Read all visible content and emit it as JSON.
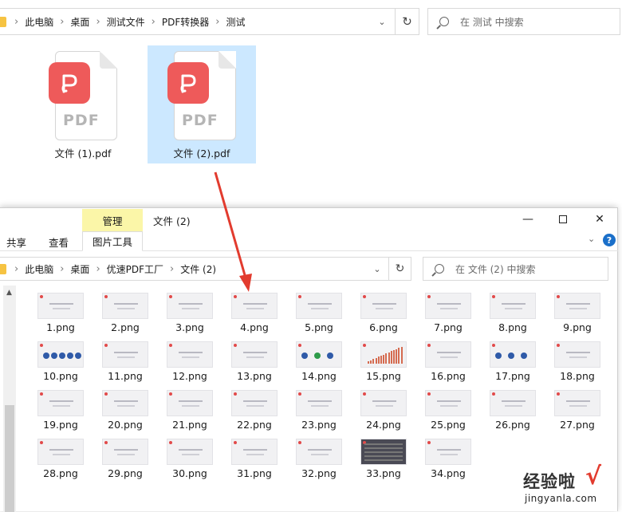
{
  "back_window": {
    "breadcrumb": [
      "此电脑",
      "桌面",
      "测试文件",
      "PDF转换器",
      "测试"
    ],
    "search_placeholder": "在 测试 中搜索",
    "files": [
      {
        "name": "文件 (1).pdf",
        "selected": false
      },
      {
        "name": "文件 (2).pdf",
        "selected": true
      }
    ],
    "pdf_badge_label": "PDF"
  },
  "front_window": {
    "title": "文件 (2)",
    "context_tab": "管理",
    "ribbon_tabs": [
      "共享",
      "查看",
      "图片工具"
    ],
    "help": "?",
    "breadcrumb": [
      "此电脑",
      "桌面",
      "优速PDF工厂",
      "文件 (2)"
    ],
    "search_placeholder": "在 文件 (2) 中搜索",
    "images": [
      "1.png",
      "2.png",
      "3.png",
      "4.png",
      "5.png",
      "6.png",
      "7.png",
      "8.png",
      "9.png",
      "10.png",
      "11.png",
      "12.png",
      "13.png",
      "14.png",
      "15.png",
      "16.png",
      "17.png",
      "18.png",
      "19.png",
      "20.png",
      "21.png",
      "22.png",
      "23.png",
      "24.png",
      "25.png",
      "26.png",
      "27.png",
      "28.png",
      "29.png",
      "30.png",
      "31.png",
      "32.png",
      "33.png",
      "34.png"
    ]
  },
  "watermark": {
    "title": "经验啦",
    "check": "√",
    "url": "jingyanla.com"
  },
  "colors": {
    "pdf_red": "#ee5a5a",
    "selection_blue": "#cce8ff",
    "context_tab_yellow": "#fbf6a8",
    "arrow_red": "#e23b2e"
  }
}
